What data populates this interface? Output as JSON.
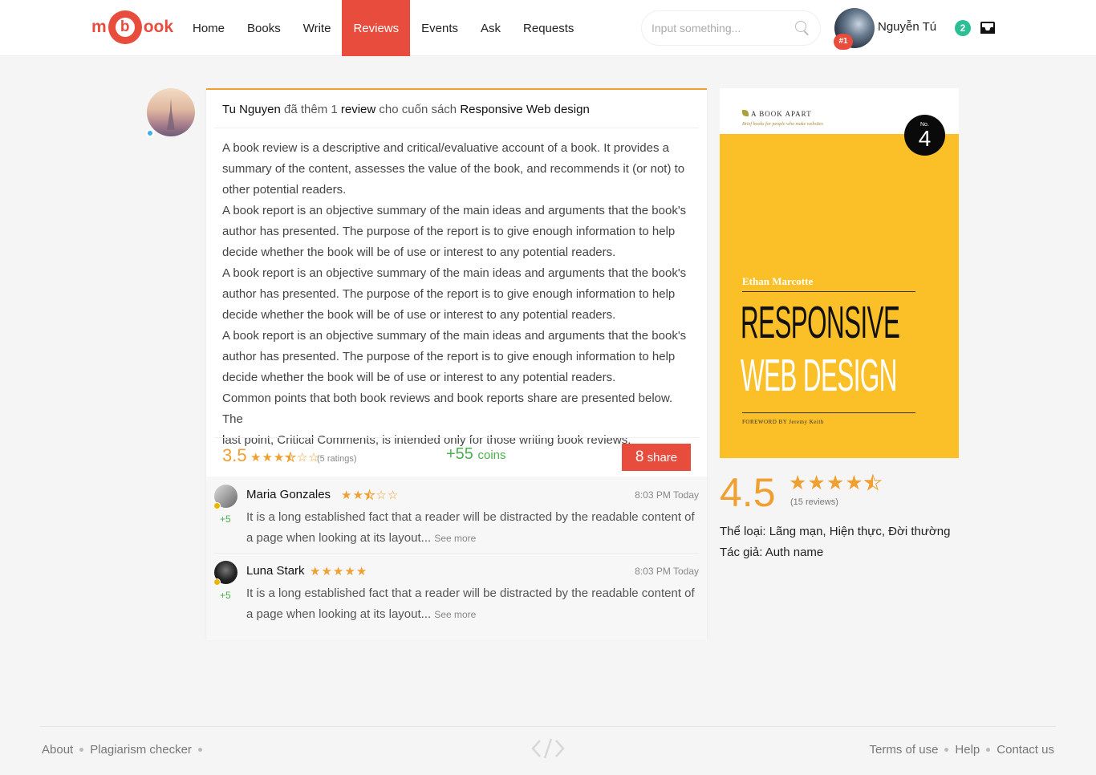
{
  "header": {
    "logo": {
      "left": "m",
      "center": "b",
      "right": "ook"
    },
    "nav": [
      "Home",
      "Books",
      "Write",
      "Reviews",
      "Events",
      "Ask",
      "Requests"
    ],
    "active_nav": "Reviews",
    "search_placeholder": "Input something...",
    "user_name": "Nguyễn Tú",
    "user_rank": "#1",
    "notification_count": "2"
  },
  "review": {
    "author": "Tu Nguyen",
    "action_text": "đã thêm 1",
    "review_word": "review",
    "for_book_text": "cho cuốn sách",
    "book_title": "Responsive Web design",
    "body_lines": [
      "A book review is a descriptive and critical/evaluative account of a book. It provides a",
      "summary of the content, assesses the value of the book, and recommends it (or not) to",
      "other potential readers.",
      "A book report is an objective summary of the main ideas and arguments that the book's",
      "author has presented. The purpose of the report is to give enough information to help",
      "decide whether the book will be of use or interest to any potential readers.",
      "A book report is an objective summary of the main ideas and arguments that the book's",
      "author has presented. The purpose of the report is to give enough information to help",
      "decide whether the book will be of use or interest to any potential readers.",
      "A book report is an objective summary of the main ideas and arguments that the book's",
      "author has presented. The purpose of the report is to give enough information to help",
      "decide whether the book will be of use or interest to any potential readers.",
      "Common points that both book reviews and book reports share are presented below. The",
      "last point, Critical Comments, is intended only for those writing book reviews."
    ],
    "rating_score": "3.5",
    "rating_value": 3.5,
    "rating_max": 6,
    "rating_count": "(5 ratings)",
    "coins_value": "+55",
    "coins_label": "coins",
    "share_count": "8",
    "share_label": "share"
  },
  "comments": [
    {
      "name": "Maria Gonzales",
      "stars": 2.5,
      "time": "8:03 PM Today",
      "coins": "+5",
      "text_line1": "It is a long established fact that a reader will be distracted by the readable content of",
      "text_line2": "a page when looking at its layout...",
      "see_more": "See more"
    },
    {
      "name": "Luna Stark",
      "stars": 5,
      "time": "8:03 PM Today",
      "coins": "+5",
      "text_line1": "It is a long established fact that a reader will be distracted by the readable content of",
      "text_line2": "a page when looking at its layout...",
      "see_more": "See more"
    }
  ],
  "book": {
    "cover": {
      "publisher": "A BOOK APART",
      "tagline": "Brief books for people who make websites",
      "no_label": "No.",
      "number": "4",
      "author": "Ethan Marcotte",
      "title_line1": "RESPONSIVE",
      "title_line2": "WEB DESIGN",
      "foreword": "FOREWORD BY Jeremy Keith"
    },
    "score": "4.5",
    "score_value": 4.5,
    "reviews": "(15 reviews)",
    "genre_label": "Thể loại:",
    "genres": "Lãng mạn, Hiện thực, Đời thường",
    "author_label": "Tác giả:",
    "author_name": "Auth name"
  },
  "footer": {
    "left_links": [
      "About",
      "Plagiarism checker"
    ],
    "right_links": [
      "Terms of use",
      "Help",
      "Contact us"
    ]
  },
  "colors": {
    "brand_red": "#e84c3d",
    "star_orange": "#f0a030",
    "coins_green": "#4caf50",
    "badge_teal": "#2cbf95",
    "cover_yellow": "#fbbf28"
  },
  "icons": [
    "search-icon",
    "inbox-icon",
    "star-icon",
    "code-icon"
  ]
}
